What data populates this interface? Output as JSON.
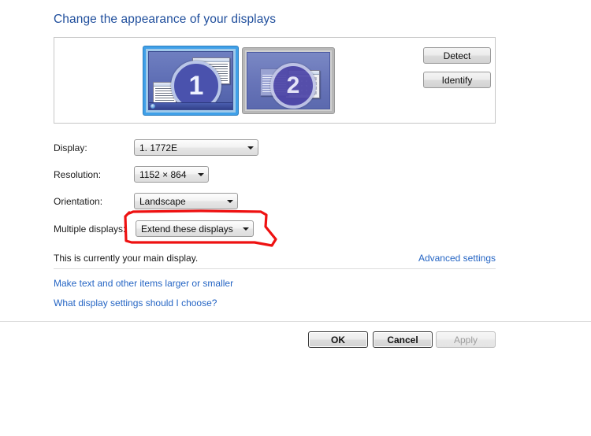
{
  "page": {
    "title": "Change the appearance of your displays"
  },
  "preview": {
    "monitors": [
      {
        "number": "1",
        "selected": true
      },
      {
        "number": "2",
        "selected": false
      }
    ],
    "detect_label": "Detect",
    "identify_label": "Identify"
  },
  "form": {
    "rows": [
      {
        "label": "Display:",
        "value": "1. 1772E"
      },
      {
        "label": "Resolution:",
        "value": "1152 × 864"
      },
      {
        "label": "Orientation:",
        "value": "Landscape"
      },
      {
        "label": "Multiple displays:",
        "value": "Extend these displays"
      }
    ]
  },
  "status": {
    "main_display_text": "This is currently your main display.",
    "advanced_settings_label": "Advanced settings"
  },
  "links": {
    "larger_smaller": "Make text and other items larger or smaller",
    "what_settings": "What display settings should I choose?"
  },
  "buttons": {
    "ok": "OK",
    "cancel": "Cancel",
    "apply": "Apply"
  },
  "annotation": {
    "shape": "hand-drawn-red-outline",
    "color": "#ee1111",
    "target": "Multiple displays dropdown"
  },
  "colors": {
    "title_blue": "#1f4e9c",
    "link_blue": "#2565c4",
    "selection_blue": "#3fa0e8",
    "annotation_red": "#ee1111",
    "panel_border": "#c6c6c6"
  }
}
